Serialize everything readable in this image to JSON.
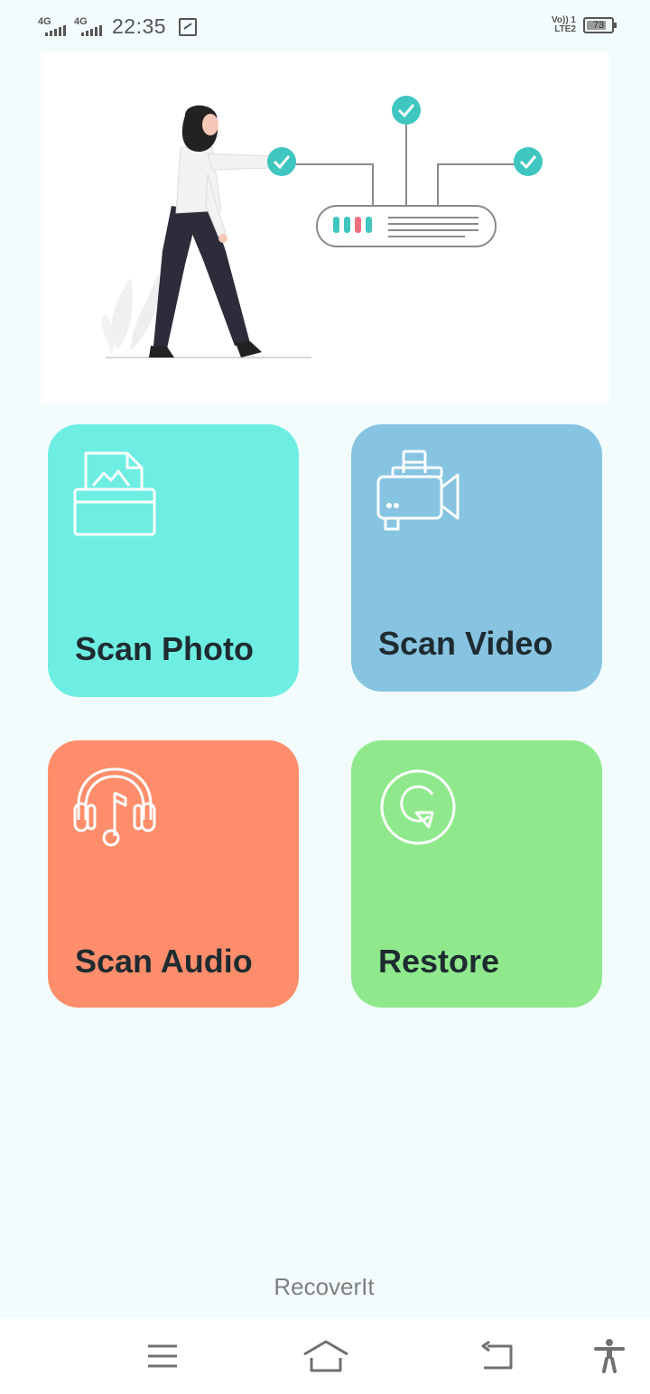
{
  "status_bar": {
    "network1": "4G",
    "network2": "4G",
    "time": "22:35",
    "volte_line1": "Vo)) 1",
    "volte_line2": "LTE2",
    "battery": "73"
  },
  "cards": {
    "photo": {
      "label": "Scan Photo",
      "icon": "image-folder-icon",
      "color": "#6eeee2"
    },
    "video": {
      "label": "Scan Video",
      "icon": "video-camera-icon",
      "color": "#86c4e2"
    },
    "audio": {
      "label": "Scan Audio",
      "icon": "headphones-music-icon",
      "color": "#fe8e6b"
    },
    "restore": {
      "label": "Restore",
      "icon": "restore-arrow-icon",
      "color": "#8fe98c"
    }
  },
  "footer": {
    "app_name": "RecoverIt"
  },
  "nav": {
    "menu_icon": "menu-icon",
    "home_icon": "home-icon",
    "back_icon": "back-icon",
    "accessibility_icon": "accessibility-icon"
  }
}
